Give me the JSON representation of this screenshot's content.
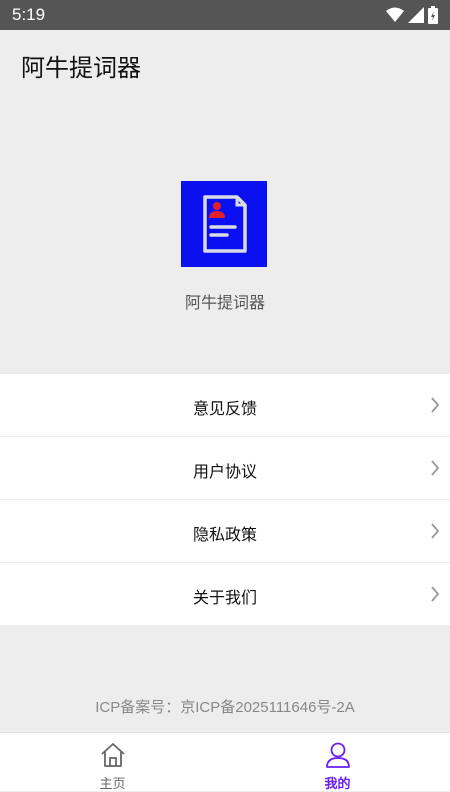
{
  "status_bar": {
    "time": "5:19"
  },
  "app_bar": {
    "title": "阿牛提词器"
  },
  "app_info": {
    "name": "阿牛提词器",
    "logo_color": "#0a10f0"
  },
  "menu": {
    "items": [
      {
        "label": "意见反馈"
      },
      {
        "label": "用户协议"
      },
      {
        "label": "隐私政策"
      },
      {
        "label": "关于我们"
      }
    ]
  },
  "footer": {
    "icp": "ICP备案号：京ICP备2025111646号-2A"
  },
  "bottom_nav": {
    "items": [
      {
        "label": "主页",
        "icon": "home-icon",
        "active": false
      },
      {
        "label": "我的",
        "icon": "user-icon",
        "active": true
      }
    ],
    "active_color": "#6a1ff0"
  }
}
